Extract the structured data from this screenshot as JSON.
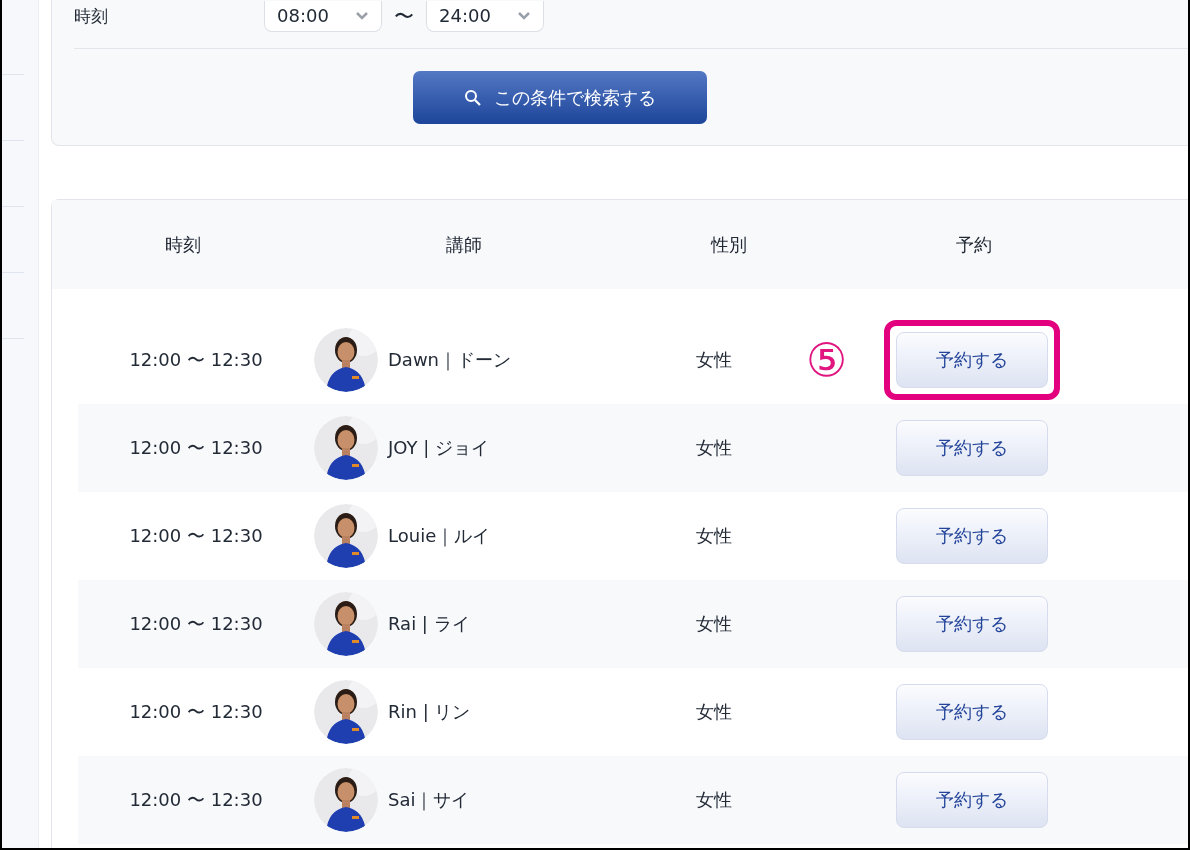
{
  "filter": {
    "label": "時刻",
    "from": "08:00",
    "separator": "〜",
    "to": "24:00",
    "search_button": "この条件で検索する"
  },
  "table": {
    "columns": [
      "時刻",
      "講師",
      "性別",
      "予約"
    ],
    "rows": [
      {
        "time": "12:00 〜 12:30",
        "teacher": "Dawn｜ドーン",
        "gender": "女性",
        "button": "予約する",
        "highlighted": true,
        "marker": "⑤"
      },
      {
        "time": "12:00 〜 12:30",
        "teacher": "JOY | ジョイ",
        "gender": "女性",
        "button": "予約する",
        "highlighted": false
      },
      {
        "time": "12:00 〜 12:30",
        "teacher": "Louie｜ルイ",
        "gender": "女性",
        "button": "予約する",
        "highlighted": false
      },
      {
        "time": "12:00 〜 12:30",
        "teacher": "Rai | ライ",
        "gender": "女性",
        "button": "予約する",
        "highlighted": false
      },
      {
        "time": "12:00 〜 12:30",
        "teacher": "Rin | リン",
        "gender": "女性",
        "button": "予約する",
        "highlighted": false
      },
      {
        "time": "12:00 〜 12:30",
        "teacher": "Sai｜サイ",
        "gender": "女性",
        "button": "予約する",
        "highlighted": false
      }
    ]
  }
}
